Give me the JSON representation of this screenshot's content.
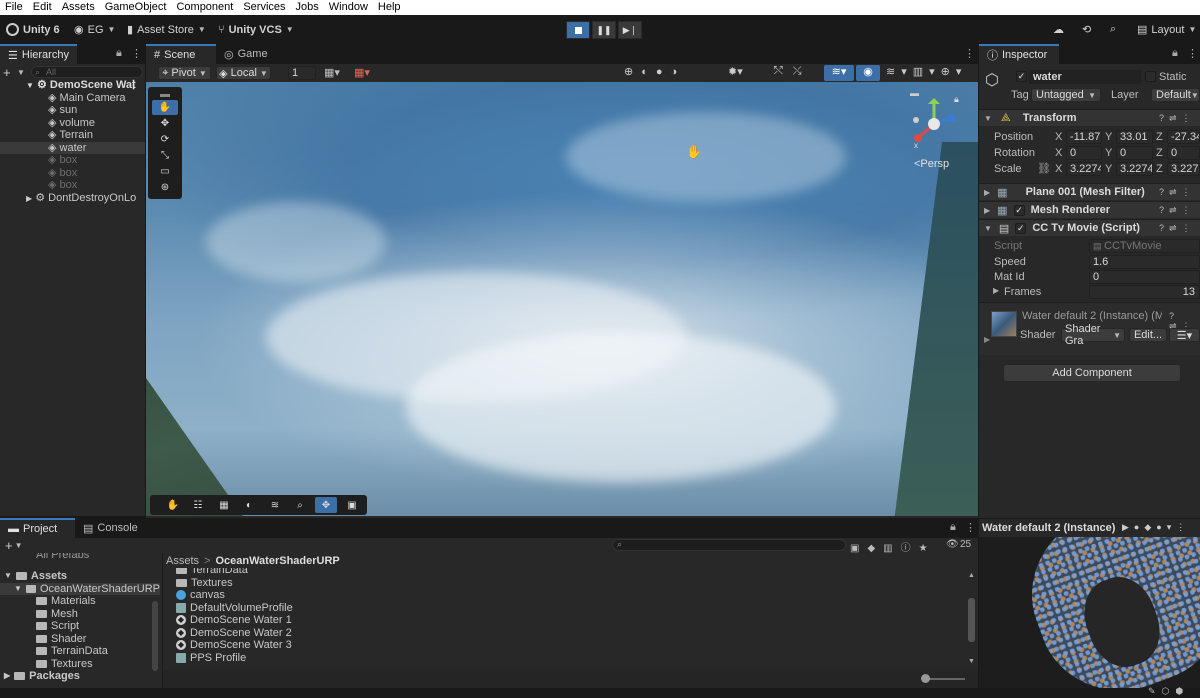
{
  "menu": [
    "File",
    "Edit",
    "Assets",
    "GameObject",
    "Component",
    "Services",
    "Jobs",
    "Window",
    "Help"
  ],
  "toolbar": {
    "unity": "Unity 6",
    "account": "EG",
    "asset_store": "Asset Store",
    "vcs": "Unity VCS",
    "layout": "Layout"
  },
  "hierarchy": {
    "tab": "Hierarchy",
    "search_placeholder": "All",
    "items": [
      {
        "label": "DemoScene Wat"
      },
      {
        "label": "Main Camera"
      },
      {
        "label": "sun"
      },
      {
        "label": "volume"
      },
      {
        "label": "Terrain"
      },
      {
        "label": "water"
      },
      {
        "label": "box"
      },
      {
        "label": "box"
      },
      {
        "label": "box"
      },
      {
        "label": "DontDestroyOnLo"
      }
    ]
  },
  "scene": {
    "tab_scene": "Scene",
    "tab_game": "Game",
    "pivot": "Pivot",
    "local": "Local",
    "grid_value": "1",
    "persp": "<Persp"
  },
  "inspector": {
    "tab": "Inspector",
    "object_name": "water",
    "static": "Static",
    "tag_label": "Tag",
    "tag_value": "Untagged",
    "layer_label": "Layer",
    "layer_value": "Default",
    "transform": {
      "title": "Transform",
      "position_label": "Position",
      "rotation_label": "Rotation",
      "scale_label": "Scale",
      "position": {
        "x": "-11.87",
        "y": "33.01",
        "z": "-27.34"
      },
      "rotation": {
        "x": "0",
        "y": "0",
        "z": "0"
      },
      "scale": {
        "x": "3.2274",
        "y": "3.2274",
        "z": "3.2274"
      }
    },
    "mesh_filter": "Plane 001 (Mesh Filter)",
    "mesh_renderer": "Mesh Renderer",
    "script_comp": {
      "title": "CC Tv Movie (Script)",
      "script_label": "Script",
      "script_value": "CCTvMovie",
      "speed_label": "Speed",
      "speed_value": "1.6",
      "matid_label": "Mat Id",
      "matid_value": "0",
      "frames_label": "Frames",
      "frames_value": "13"
    },
    "material": {
      "name": "Water default 2 (Instance) (M",
      "shader_label": "Shader",
      "shader_value": "Shader Gra",
      "edit": "Edit..."
    },
    "add_component": "Add Component"
  },
  "project": {
    "tab_project": "Project",
    "tab_console": "Console",
    "count": "25",
    "tree_top": "All Prefabs",
    "tree": [
      {
        "label": "Assets",
        "level": 0
      },
      {
        "label": "OceanWaterShaderURP",
        "level": 1
      },
      {
        "label": "Materials",
        "level": 2
      },
      {
        "label": "Mesh",
        "level": 2
      },
      {
        "label": "Script",
        "level": 2
      },
      {
        "label": "Shader",
        "level": 2
      },
      {
        "label": "TerrainData",
        "level": 2
      },
      {
        "label": "Textures",
        "level": 2
      },
      {
        "label": "Packages",
        "level": 0
      }
    ],
    "breadcrumb_root": "Assets",
    "breadcrumb_sep": ">",
    "breadcrumb_current": "OceanWaterShaderURP",
    "files": [
      {
        "label": "TerrainData",
        "kind": "folder"
      },
      {
        "label": "Textures",
        "kind": "folder"
      },
      {
        "label": "canvas",
        "kind": "prefab"
      },
      {
        "label": "DefaultVolumeProfile",
        "kind": "asset"
      },
      {
        "label": "DemoScene Water 1",
        "kind": "scene"
      },
      {
        "label": "DemoScene Water 2",
        "kind": "scene"
      },
      {
        "label": "DemoScene Water 3",
        "kind": "scene"
      },
      {
        "label": "PPS Profile",
        "kind": "asset"
      }
    ]
  },
  "preview": {
    "title": "Water default 2 (Instance)"
  }
}
